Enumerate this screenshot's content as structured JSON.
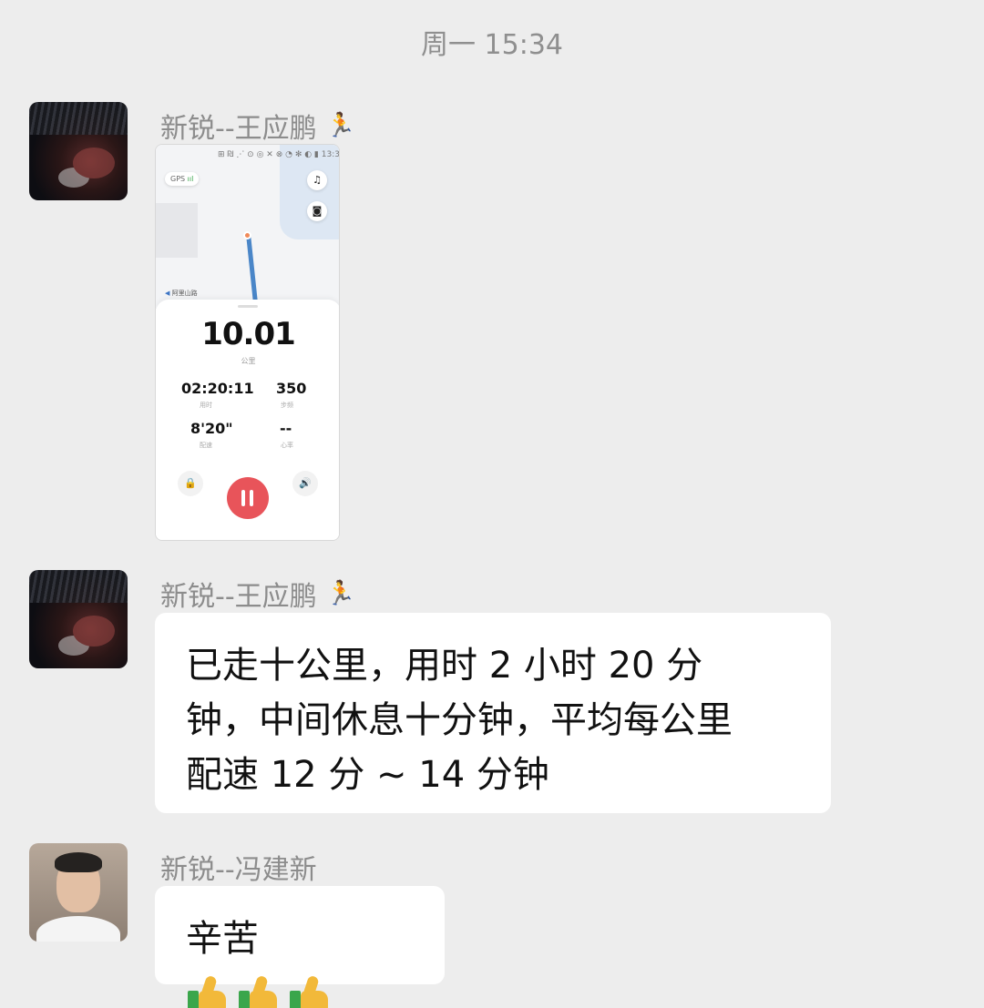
{
  "timestamp": "周一 15:34",
  "messages": [
    {
      "sender": "新锐--王应鹏",
      "type": "image",
      "screenshot": {
        "status_bar": "⊞ ₪ ⋰ ⊙ ◎ ✕ ⊗ ◔ ✻ ◐ ▮ 13:33",
        "gps": "GPS",
        "gps_signal": "ııl",
        "music_icon": "♫",
        "camera_icon": "◙",
        "location_label": "阿里山路",
        "distance": "10.01",
        "distance_unit": "公里",
        "duration": "02:20:11",
        "duration_label": "用时",
        "steps": "350",
        "steps_label": "步频",
        "pace": "8'20\"",
        "pace_label": "配速",
        "heart_rate": "--",
        "heart_rate_label": "心率",
        "lock_icon": "🔒",
        "sound_icon": "🔊"
      }
    },
    {
      "sender": "新锐--王应鹏",
      "type": "text",
      "lines": [
        "已走十公里，用时 2 小时 20 分",
        "钟，中间休息十分钟，平均每公里",
        "配速 12 分 ~ 14 分钟"
      ]
    },
    {
      "sender": "新锐--冯建新",
      "type": "text",
      "text": "辛苦",
      "emoji_count": 3
    }
  ]
}
